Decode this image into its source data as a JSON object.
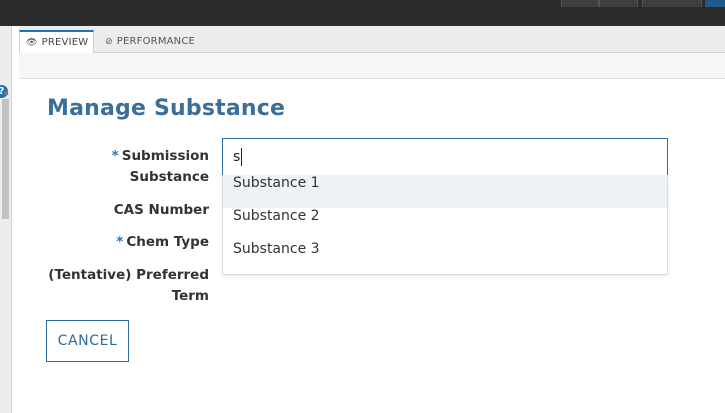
{
  "tabs": {
    "preview": "PREVIEW",
    "performance": "PERFORMANCE"
  },
  "page_title": "Manage Substance",
  "form": {
    "required_marker": "*",
    "submission_substance": {
      "label_line1": "Submission",
      "label_line2": "Substance",
      "value": "s"
    },
    "cas_number": {
      "label": "CAS Number"
    },
    "chem_type": {
      "label": "Chem Type"
    },
    "preferred_term": {
      "label_line1": "(Tentative) Preferred",
      "label_line2": "Term"
    }
  },
  "dropdown": {
    "options": [
      "Substance 1",
      "Substance 2",
      "Substance 3"
    ],
    "highlighted_index": 0
  },
  "buttons": {
    "cancel": "CANCEL"
  },
  "icons": {
    "preview": "eye-icon",
    "performance": "gauge-icon",
    "help": "help-icon"
  },
  "colors": {
    "accent": "#2e6d9e",
    "heading": "#3a6f9c",
    "required": "#2a74b4"
  }
}
